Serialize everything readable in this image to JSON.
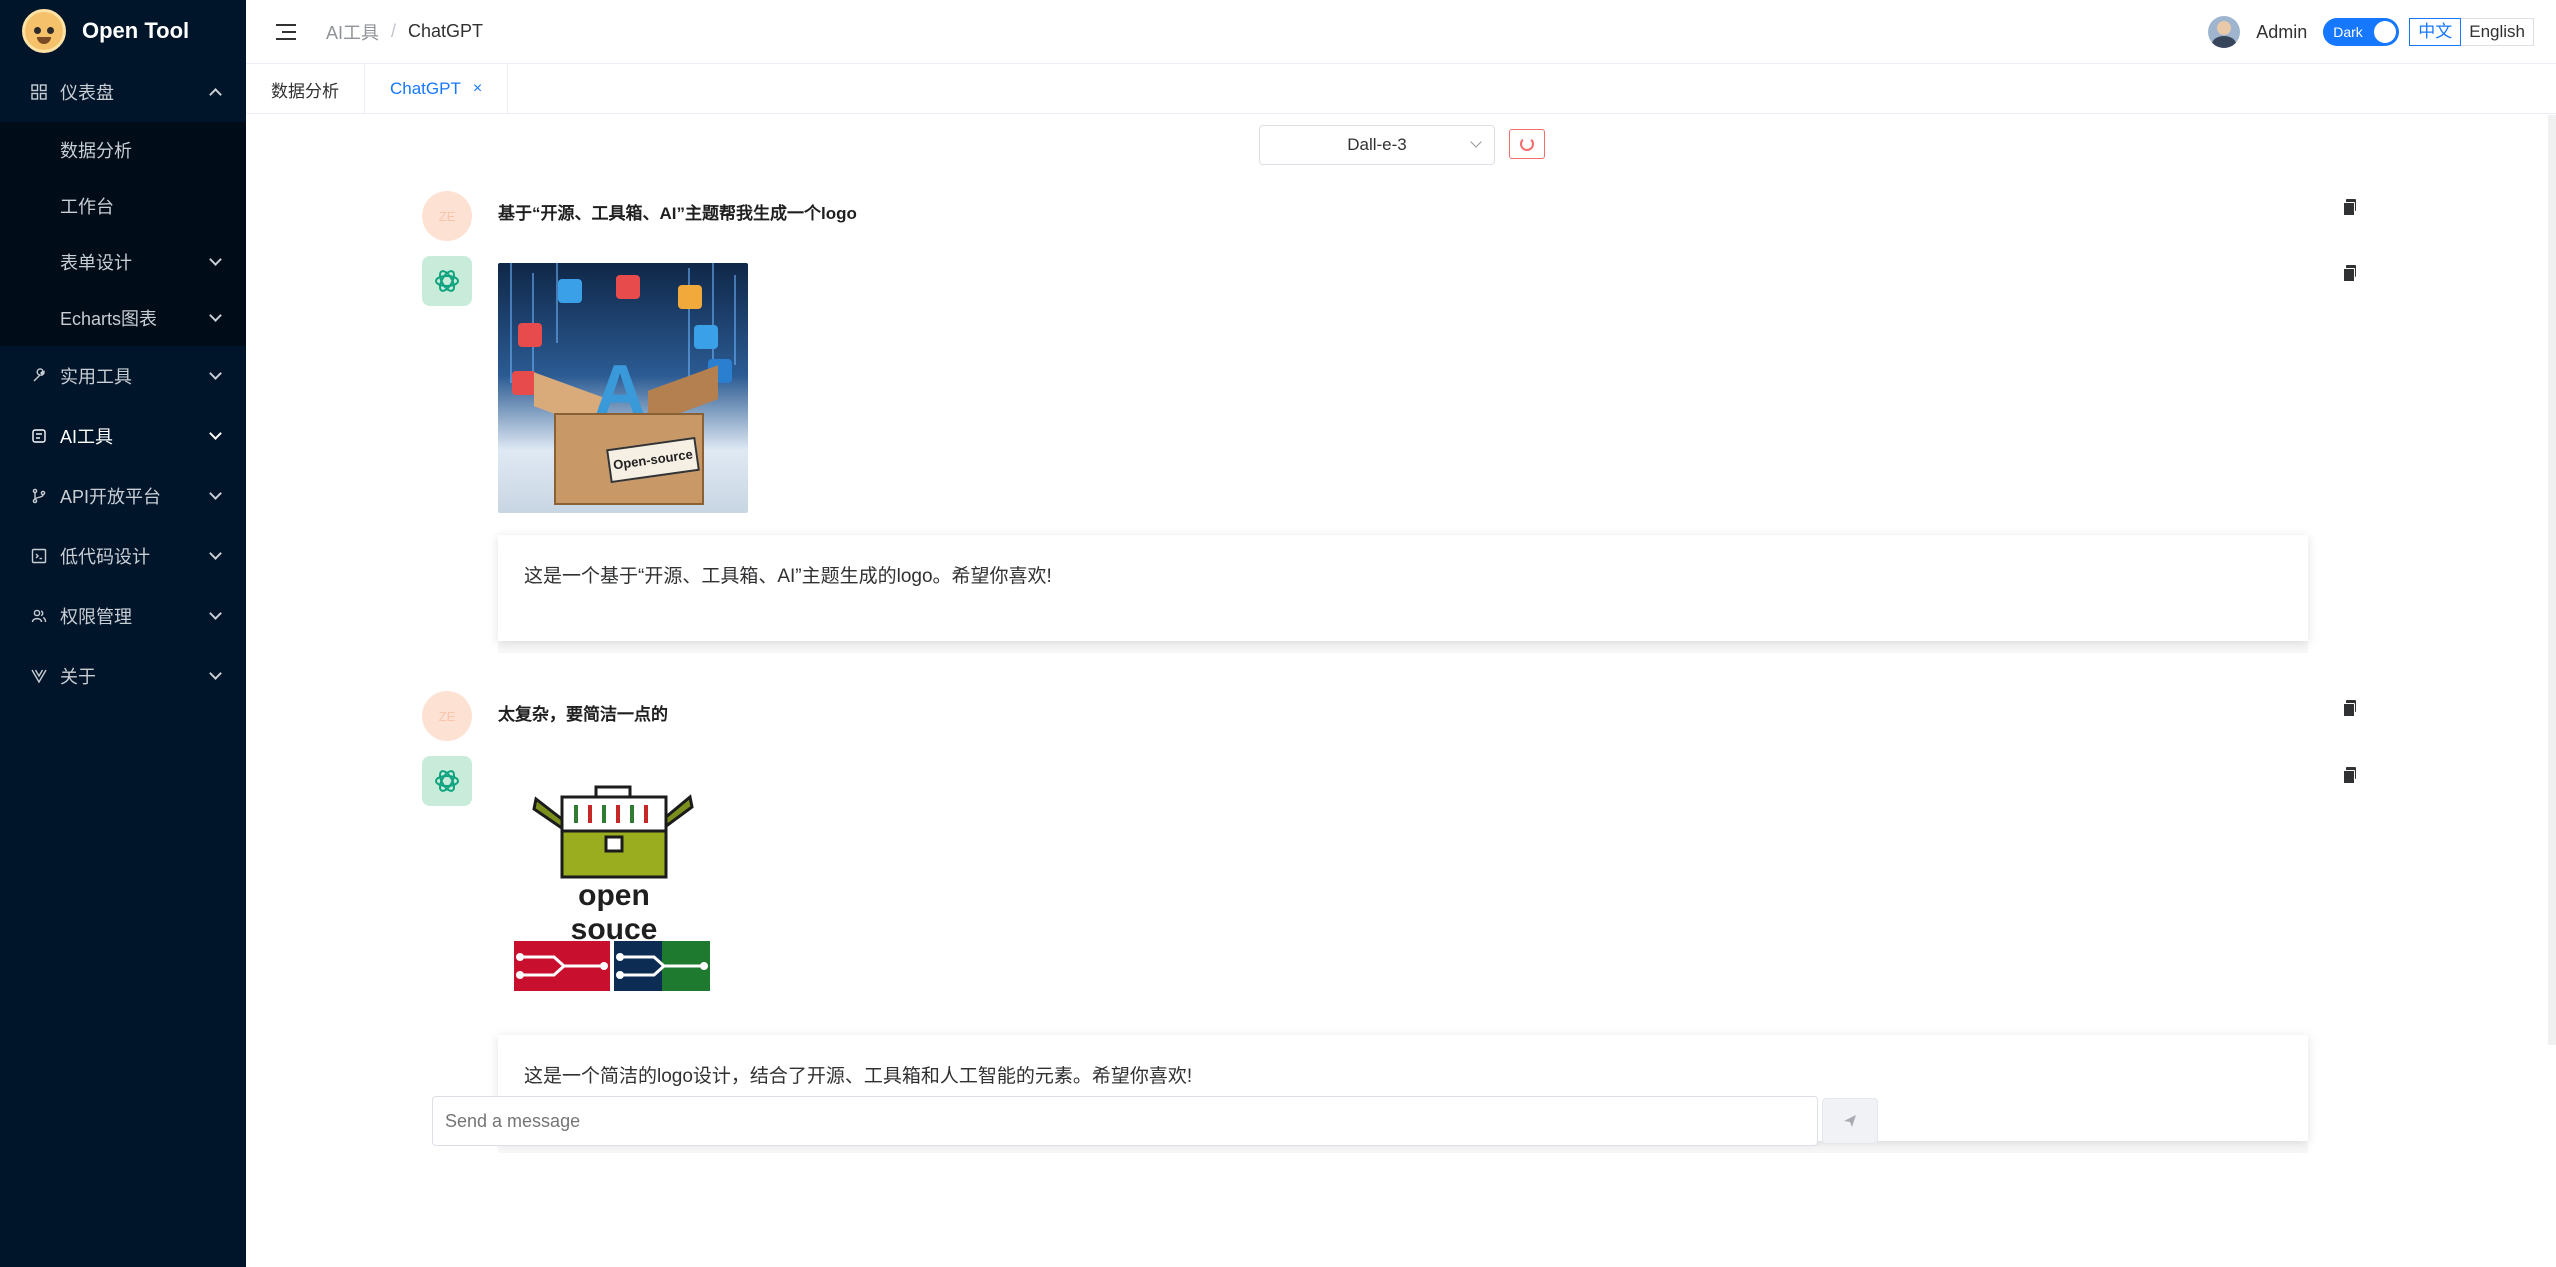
{
  "app": {
    "title": "Open Tool"
  },
  "sidebar": {
    "items": [
      {
        "label": "仪表盘",
        "icon": "grid-icon",
        "expanded": true,
        "children": [
          {
            "label": "数据分析"
          },
          {
            "label": "工作台"
          },
          {
            "label": "表单设计",
            "has_children": true
          },
          {
            "label": "Echarts图表",
            "has_children": true
          }
        ]
      },
      {
        "label": "实用工具",
        "icon": "wrench-icon"
      },
      {
        "label": "AI工具",
        "icon": "ai-icon",
        "active": true
      },
      {
        "label": "API开放平台",
        "icon": "branch-icon"
      },
      {
        "label": "低代码设计",
        "icon": "code-icon"
      },
      {
        "label": "权限管理",
        "icon": "users-icon"
      },
      {
        "label": "关于",
        "icon": "vue-icon"
      }
    ]
  },
  "header": {
    "breadcrumb": [
      "AI工具",
      "ChatGPT"
    ],
    "admin_name": "Admin",
    "dark_toggle_label": "Dark",
    "lang_zh": "中文",
    "lang_en": "English"
  },
  "tabs": [
    {
      "label": "数据分析",
      "active": false
    },
    {
      "label": "ChatGPT",
      "active": true,
      "close": "×"
    }
  ],
  "chat": {
    "model": "Dall-e-3",
    "user_avatar_text": "ZE",
    "messages": [
      {
        "user": "基于“开源、工具箱、AI”主题帮我生成一个logo",
        "answer": "这是一个基于“开源、工具箱、AI”主题生成的logo。希望你喜欢!",
        "image_label": "Open-source"
      },
      {
        "user": "太复杂，要简洁一点的",
        "answer": "这是一个简洁的logo设计，结合了开源、工具箱和人工智能的元素。希望你喜欢!",
        "image_label": "open souce"
      }
    ],
    "input_placeholder": "Send a message"
  },
  "colors": {
    "sidebar_bg": "#001529",
    "accent": "#1677ff",
    "danger": "#f56c6c",
    "gpt_avatar_bg": "#c8ecd9",
    "user_avatar_bg": "#fde2d4"
  }
}
